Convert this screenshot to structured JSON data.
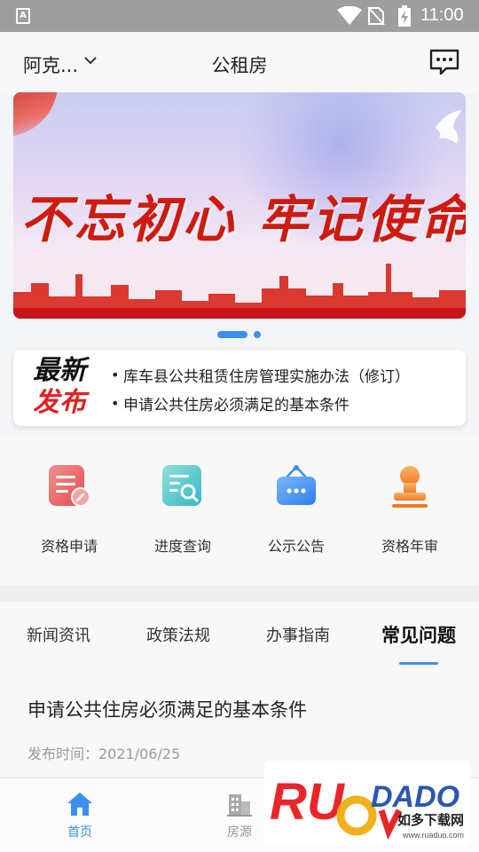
{
  "status_bar": {
    "time": "11:00",
    "sim_label": "A"
  },
  "header": {
    "city": "阿克...",
    "title": "公租房"
  },
  "banner": {
    "slogan": "不忘初心 牢记使命",
    "page_count": 2,
    "active_page": 1
  },
  "news": {
    "badge_line1": "最新",
    "badge_line2": "发布",
    "items": [
      "库车县公共租赁住房管理实施办法（修订）",
      "申请公共住房必须满足的基本条件"
    ]
  },
  "features": [
    {
      "label": "资格申请",
      "icon": "application-form-icon",
      "color": "#ec5d5d"
    },
    {
      "label": "进度查询",
      "icon": "progress-search-icon",
      "color": "#3fc5c6"
    },
    {
      "label": "公示公告",
      "icon": "notice-board-icon",
      "color": "#3b8df2"
    },
    {
      "label": "资格年审",
      "icon": "seal-stamp-icon",
      "color": "#f0852c"
    }
  ],
  "tabs": [
    {
      "label": "新闻资讯",
      "active": false
    },
    {
      "label": "政策法规",
      "active": false
    },
    {
      "label": "办事指南",
      "active": false
    },
    {
      "label": "常见问题",
      "active": true
    }
  ],
  "article": {
    "title": "申请公共住房必须满足的基本条件",
    "date": "发布时间：2021/06/25"
  },
  "bottom_nav": [
    {
      "label": "首页",
      "icon": "home-icon",
      "active": true
    },
    {
      "label": "房源",
      "icon": "building-icon",
      "active": false
    }
  ],
  "watermark": {
    "brand": "RUADADO",
    "subtitle": "如多下载网",
    "url": "www.ruaduo.com"
  },
  "colors": {
    "accent": "#3d8ef0",
    "badge_red": "#e0211f",
    "slogan_red": "#cf1a10"
  }
}
